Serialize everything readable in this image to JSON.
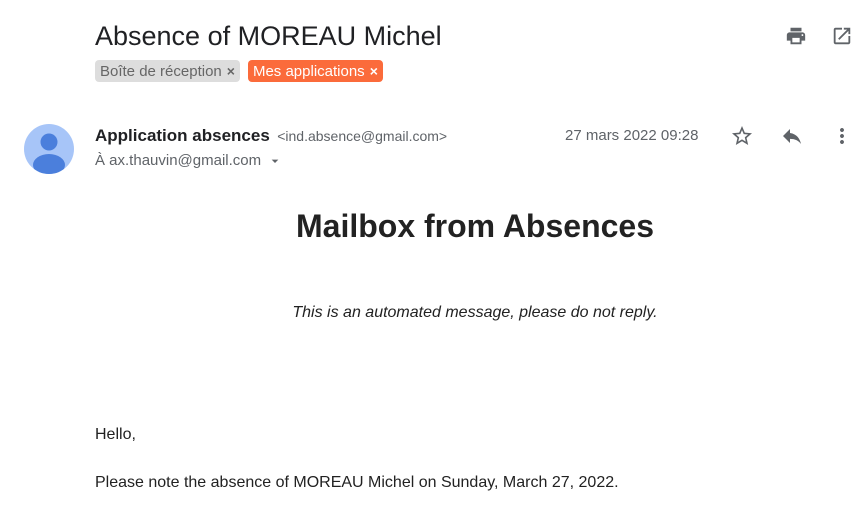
{
  "email": {
    "subject": "Absence of MOREAU Michel",
    "labels": [
      {
        "name": "Boîte de réception",
        "close": "×",
        "color": "#dddddd"
      },
      {
        "name": "Mes applications",
        "close": "×",
        "color": "#fb6b3b"
      }
    ],
    "sender": {
      "name": "Application absences",
      "email": "<ind.absence@gmail.com>"
    },
    "recipient": "À ax.thauvin@gmail.com",
    "date": "27 mars 2022 09:28",
    "body": {
      "title": "Mailbox from Absences",
      "note": "This is an automated message, please do not reply.",
      "greeting": "Hello,",
      "text": "Please note the absence of MOREAU Michel on Sunday, March 27, 2022."
    }
  },
  "icons": {
    "print": "print-icon",
    "open_new_window": "open-in-new-window-icon",
    "star": "star-icon",
    "reply": "reply-icon",
    "more": "more-vertical-icon",
    "dropdown": "chevron-down-icon"
  },
  "colors": {
    "accent_label": "#fb6b3b",
    "avatar_bg": "#a7c5f8",
    "avatar_fg": "#4b7fdc"
  }
}
